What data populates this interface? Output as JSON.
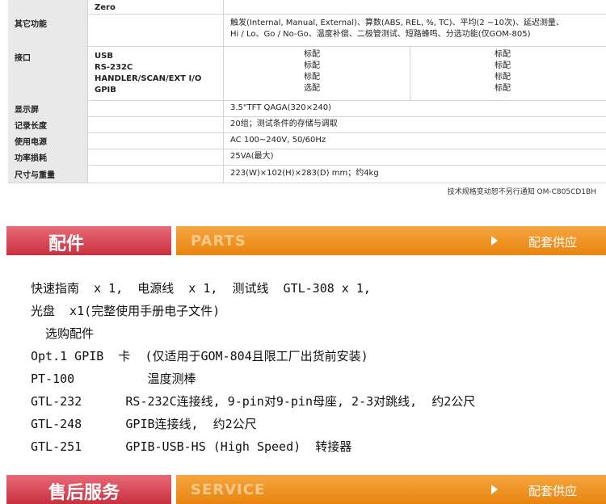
{
  "spec": {
    "zero": "Zero",
    "other": {
      "label": "其它功能",
      "line1": "触发(Internal, Manual, External)、算数(ABS, REL, %, TC)、平均(2 ~10次)、延迟测量、",
      "line2": "Hi / Lo、Go / No-Go、温度补偿、二极管测试、短路蜂鸣、分选功能(仅GOM-805)"
    },
    "interface": {
      "label": "接口",
      "items": [
        "USB",
        "RS-232C",
        "HANDLER/SCAN/EXT I/O",
        "GPIB"
      ],
      "col1": [
        "标配",
        "标配",
        "标配",
        "选配"
      ],
      "col2": [
        "标配",
        "标配",
        "标配",
        "标配"
      ]
    },
    "display": {
      "label": "显示屏",
      "value": "3.5\"TFT QAGA(320×240)"
    },
    "memory": {
      "label": "记录长度",
      "value": "20组；测试条件的存储与调取"
    },
    "power": {
      "label": "使用电源",
      "value": "AC 100~240V, 50/60Hz"
    },
    "consumption": {
      "label": "功率损耗",
      "value": "25VA(最大)"
    },
    "size": {
      "label": "尺寸与重量",
      "value": "223(W)×102(H)×283(D) mm；约4kg"
    },
    "note": "技术规格变动恕不另行通知  OM-C805CD1BH"
  },
  "parts_band": {
    "title_cn": "配件",
    "title_en": "PARTS",
    "link": "配套供应"
  },
  "accessories": [
    "快速指南  x 1,  电源线  x 1,  测试线  GTL-308 x 1,",
    "光盘  x1(完整使用手册电子文件)",
    "  选购配件",
    "Opt.1 GPIB  卡  (仅适用于GOM-804且限工厂出货前安装)",
    "PT-100          温度测棒",
    "GTL-232      RS-232C连接线, 9-pin对9-pin母座, 2-3对跳线,  约2公尺",
    "GTL-248      GPIB连接线,  约2公尺",
    "GTL-251      GPIB-USB-HS (High Speed)  转接器"
  ],
  "service_band": {
    "title_cn": "售后服务",
    "title_en": "SERVICE",
    "link": "配套供应"
  }
}
